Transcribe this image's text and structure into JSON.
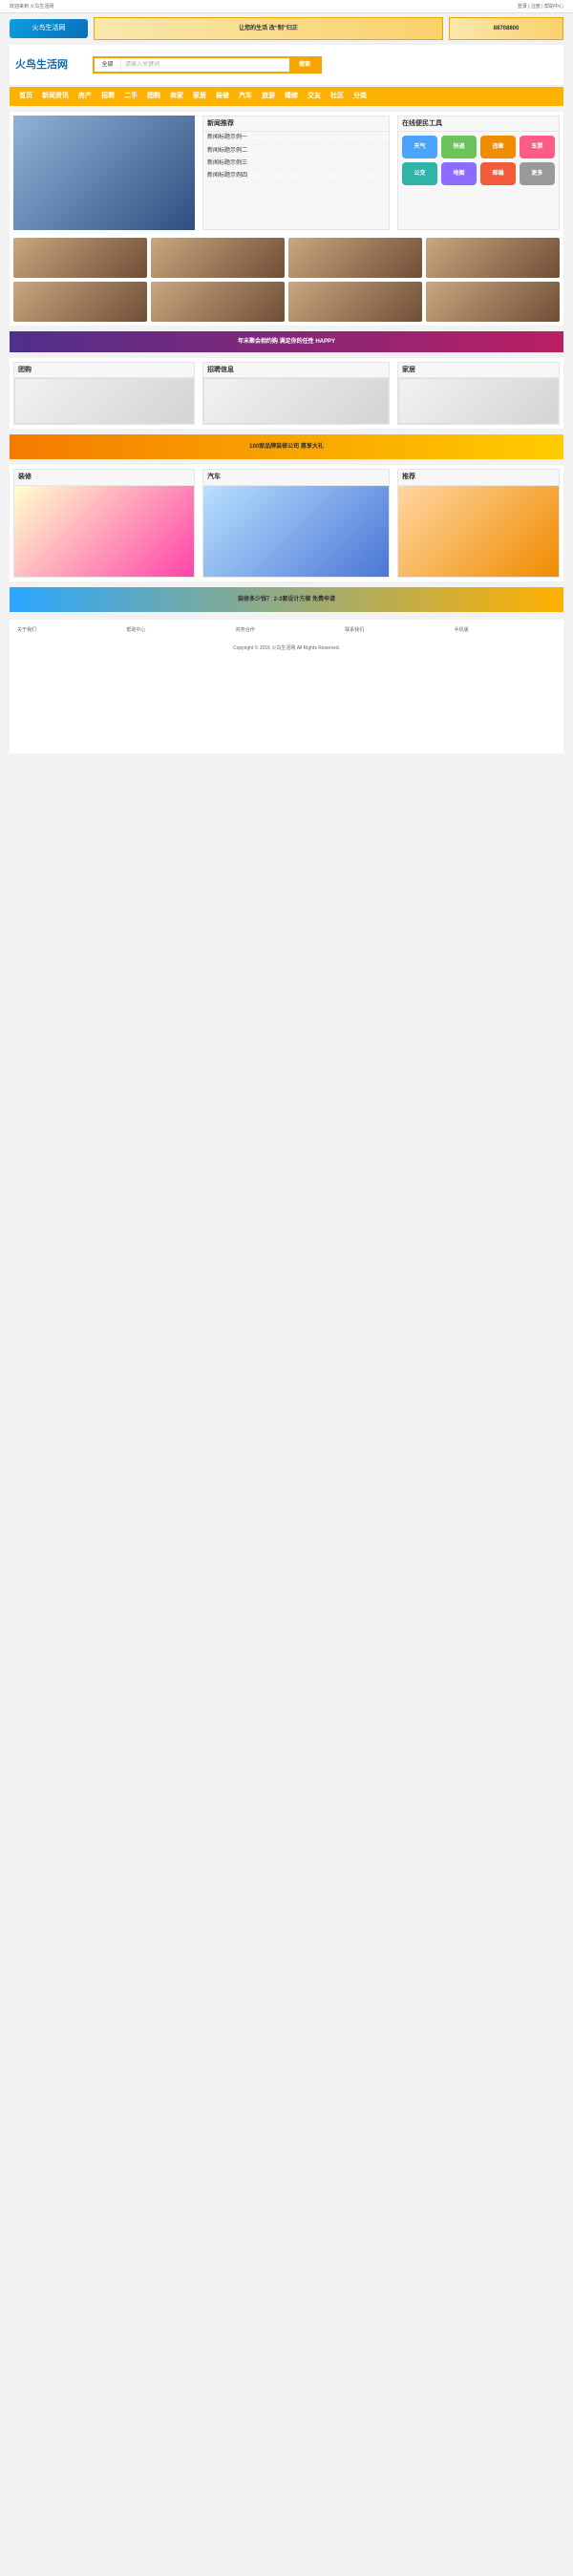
{
  "topbar": {
    "left": "欢迎来到 火鸟生活网",
    "right": "登录 | 注册 | 帮助中心"
  },
  "banner": {
    "brand": "火鸟生活网",
    "ad1": "让您的生活 改“制”归正",
    "phone": "88708800"
  },
  "search": {
    "scope": "全部",
    "placeholder": "请输入关键词",
    "button": "搜索"
  },
  "nav": [
    "首页",
    "新闻资讯",
    "房产",
    "招聘",
    "二手",
    "团购",
    "商家",
    "家居",
    "装修",
    "汽车",
    "旅游",
    "婚嫁",
    "交友",
    "社区",
    "分类"
  ],
  "sections": {
    "news": "新闻推荐",
    "tools": "在线便民工具",
    "jobs": "招聘信息",
    "deals": "团购",
    "home": "家居",
    "decor": "装修",
    "car": "汽车",
    "footer": "Copyright © 2016 火鸟生活网 All Rights Reserved."
  },
  "ads": {
    "top": "年末聚会相约购 满足你的任性 HAPPY",
    "mid": "100家品牌装修公司 惠享大礼",
    "bottom": "装修多少钱？ 2-3套设计方案 免费申请"
  },
  "tool_icons": [
    "天气",
    "快递",
    "违章",
    "车票",
    "公交",
    "地图",
    "邮编",
    "更多"
  ]
}
